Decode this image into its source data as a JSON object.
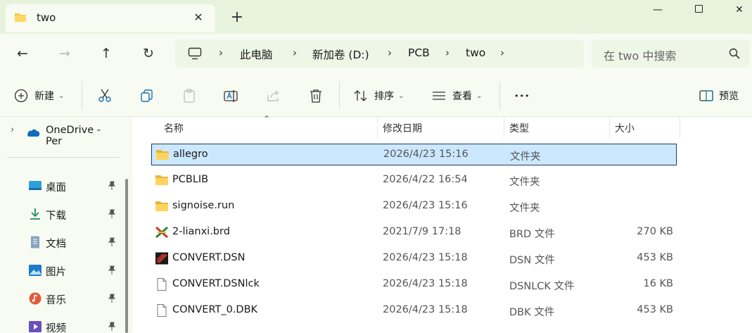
{
  "tab": {
    "title": "two",
    "close_glyph": "✕",
    "new_tab_glyph": "+"
  },
  "window": {
    "minimize_glyph": "—",
    "close_glyph": "✕"
  },
  "nav": {
    "back_glyph": "←",
    "forward_glyph": "→",
    "up_glyph": "↑",
    "refresh_glyph": "↻"
  },
  "breadcrumb": {
    "separator": "›",
    "items": [
      "此电脑",
      "新加卷 (D:)",
      "PCB",
      "two"
    ]
  },
  "search": {
    "placeholder": "在 two 中搜索"
  },
  "toolbar": {
    "new_label": "新建",
    "sort_label": "排序",
    "view_label": "查看",
    "more_glyph": "•••",
    "preview_label": "预览"
  },
  "sidebar": {
    "onedrive_label": "OneDrive - Per",
    "expand_glyph": "›",
    "items": [
      {
        "label": "桌面",
        "icon": "desktop-icon"
      },
      {
        "label": "下载",
        "icon": "download-icon"
      },
      {
        "label": "文档",
        "icon": "documents-icon"
      },
      {
        "label": "图片",
        "icon": "pictures-icon"
      },
      {
        "label": "音乐",
        "icon": "music-icon"
      },
      {
        "label": "视频",
        "icon": "videos-icon"
      }
    ]
  },
  "columns": {
    "name": "名称",
    "date": "修改日期",
    "type": "类型",
    "size": "大小",
    "sort_glyph": "⌃"
  },
  "files": [
    {
      "name": "allegro",
      "date": "2026/4/23 15:16",
      "type": "文件夹",
      "size": "",
      "icon": "folder-icon",
      "selected": true
    },
    {
      "name": "PCBLIB",
      "date": "2026/4/22 16:54",
      "type": "文件夹",
      "size": "",
      "icon": "folder-icon"
    },
    {
      "name": "signoise.run",
      "date": "2026/4/23 15:16",
      "type": "文件夹",
      "size": "",
      "icon": "folder-icon"
    },
    {
      "name": "2-lianxi.brd",
      "date": "2021/7/9 17:18",
      "type": "BRD 文件",
      "size": "270 KB",
      "icon": "brd-file-icon"
    },
    {
      "name": "CONVERT.DSN",
      "date": "2026/4/23 15:18",
      "type": "DSN 文件",
      "size": "453 KB",
      "icon": "dsn-file-icon"
    },
    {
      "name": "CONVERT.DSNlck",
      "date": "2026/4/23 15:18",
      "type": "DSNLCK 文件",
      "size": "16 KB",
      "icon": "file-icon"
    },
    {
      "name": "CONVERT_0.DBK",
      "date": "2026/4/23 15:18",
      "type": "DBK 文件",
      "size": "453 KB",
      "icon": "file-icon"
    }
  ],
  "colors": {
    "accent": "#0067c0",
    "folder": "#f7c948",
    "selection": "#cce8ff",
    "chrome": "#e8f3de"
  }
}
